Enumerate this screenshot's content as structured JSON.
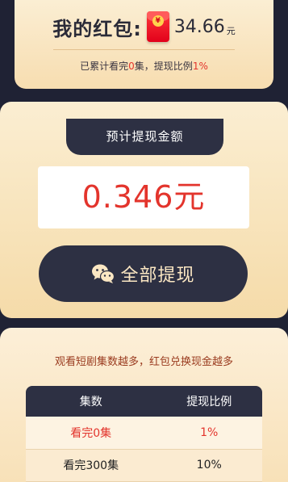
{
  "balance": {
    "label": "我的红包:",
    "amount": "34.66",
    "unit": "元",
    "envelope_icon": "red-envelope-icon",
    "coin_symbol": "¥"
  },
  "progress": {
    "prefix": "已累计看完",
    "episodes": "0",
    "middle": "集，提现比例",
    "rate": "1%"
  },
  "estimate": {
    "tab_label": "预计提现金额",
    "amount": "0.346元"
  },
  "withdraw": {
    "label": "全部提现",
    "icon": "wechat-icon"
  },
  "tip": "观看短剧集数越多，红包兑换现金越多",
  "rate_table": {
    "headers": [
      "集数",
      "提现比例"
    ],
    "rows": [
      [
        "看完0集",
        "1%"
      ],
      [
        "看完300集",
        "10%"
      ]
    ]
  },
  "colors": {
    "accent_red": "#e3342c",
    "dark_navy": "#2d3043",
    "gold_light": "#fbeed3"
  }
}
